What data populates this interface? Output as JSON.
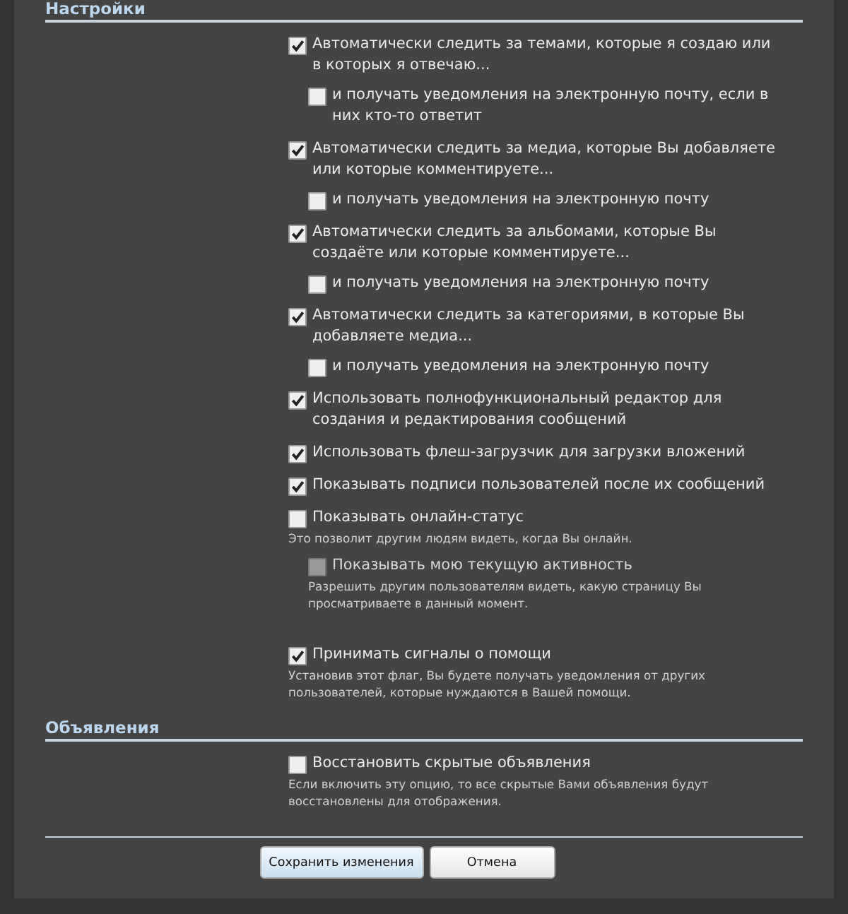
{
  "sections": [
    {
      "title": "Настройки",
      "items": [
        {
          "label": "Автоматически следить за темами, которые я создаю или в которых я отвечаю...",
          "checked": true,
          "disabled": false,
          "children": [
            {
              "label": "и получать уведомления на электронную почту, если в них кто-то ответит",
              "checked": false,
              "disabled": false
            }
          ]
        },
        {
          "label": "Автоматически следить за медиа, которые Вы добавляете или которые комментируете...",
          "checked": true,
          "disabled": false,
          "children": [
            {
              "label": "и получать уведомления на электронную почту",
              "checked": false,
              "disabled": false
            }
          ]
        },
        {
          "label": "Автоматически следить за альбомами, которые Вы создаёте или которые комментируете...",
          "checked": true,
          "disabled": false,
          "children": [
            {
              "label": "и получать уведомления на электронную почту",
              "checked": false,
              "disabled": false
            }
          ]
        },
        {
          "label": "Автоматически следить за категориями, в которые Вы добавляете медиа...",
          "checked": true,
          "disabled": false,
          "children": [
            {
              "label": "и получать уведомления на электронную почту",
              "checked": false,
              "disabled": false
            }
          ]
        },
        {
          "label": "Использовать полнофункциональный редактор для создания и редактирования сообщений",
          "checked": true,
          "disabled": false
        },
        {
          "label": "Использовать флеш-загрузчик для загрузки вложений",
          "checked": true,
          "disabled": false
        },
        {
          "label": "Показывать подписи пользователей после их сообщений",
          "checked": true,
          "disabled": false
        },
        {
          "label": "Показывать онлайн-статус",
          "checked": false,
          "disabled": false,
          "hint": "Это позволит другим людям видеть, когда Вы онлайн.",
          "children": [
            {
              "label": "Показывать мою текущую активность",
              "checked": false,
              "disabled": true,
              "hint": "Разрешить другим пользователям видеть, какую страницу Вы просматриваете в данный момент."
            }
          ]
        },
        {
          "label": "Принимать сигналы о помощи",
          "checked": true,
          "disabled": false,
          "hint": "Установив этот флаг, Вы будете получать уведомления от других пользователей, которые нуждаются в Вашей помощи."
        }
      ]
    },
    {
      "title": "Объявления",
      "items": [
        {
          "label": "Восстановить скрытые объявления",
          "checked": false,
          "disabled": false,
          "hint": "Если включить эту опцию, то все скрытые Вами объявления будут восстановлены для отображения."
        }
      ]
    }
  ],
  "buttons": [
    {
      "label": "Сохранить изменения",
      "kind": "primary"
    },
    {
      "label": "Отмена",
      "kind": "secondary"
    }
  ]
}
